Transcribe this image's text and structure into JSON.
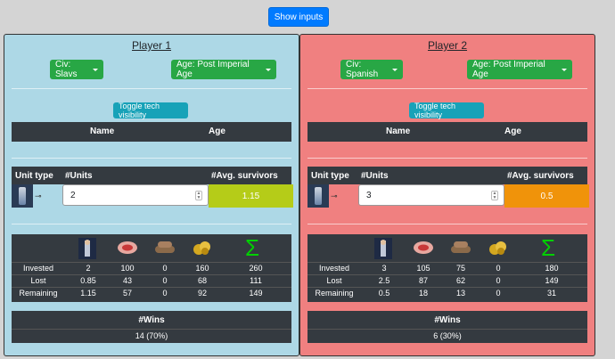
{
  "show_inputs_label": "Show inputs",
  "players": [
    {
      "title": "Player 1",
      "civ_label": "Civ: Slavs",
      "age_label": "Age: Post Imperial Age",
      "toggle_label": "Toggle tech visibility",
      "tech_headers": {
        "name": "Name",
        "age": "Age"
      },
      "unit_headers": {
        "type": "Unit type",
        "units": "#Units",
        "avg": "#Avg. survivors"
      },
      "unit_value": "2",
      "avg_survivors": "1.15",
      "avg_color": "#b5cc18",
      "rows": [
        {
          "label": "Invested",
          "values": [
            "2",
            "100",
            "0",
            "160",
            "260"
          ]
        },
        {
          "label": "Lost",
          "values": [
            "0.85",
            "43",
            "0",
            "68",
            "111"
          ]
        },
        {
          "label": "Remaining",
          "values": [
            "1.15",
            "57",
            "0",
            "92",
            "149"
          ]
        }
      ],
      "wins_header": "#Wins",
      "wins_value": "14 (70%)"
    },
    {
      "title": "Player 2",
      "civ_label": "Civ: Spanish",
      "age_label": "Age: Post Imperial Age",
      "toggle_label": "Toggle tech visibility",
      "tech_headers": {
        "name": "Name",
        "age": "Age"
      },
      "unit_headers": {
        "type": "Unit type",
        "units": "#Units",
        "avg": "#Avg. survivors"
      },
      "unit_value": "3",
      "avg_survivors": "0.5",
      "avg_color": "#f0930a",
      "rows": [
        {
          "label": "Invested",
          "values": [
            "3",
            "105",
            "75",
            "0",
            "180"
          ]
        },
        {
          "label": "Lost",
          "values": [
            "2.5",
            "87",
            "62",
            "0",
            "149"
          ]
        },
        {
          "label": "Remaining",
          "values": [
            "0.5",
            "18",
            "13",
            "0",
            "31"
          ]
        }
      ],
      "wins_header": "#Wins",
      "wins_value": "6 (30%)"
    }
  ],
  "resource_icons": [
    "population-icon",
    "food-icon",
    "wood-icon",
    "gold-icon",
    "sum-icon"
  ],
  "sum_color": "#00d000"
}
